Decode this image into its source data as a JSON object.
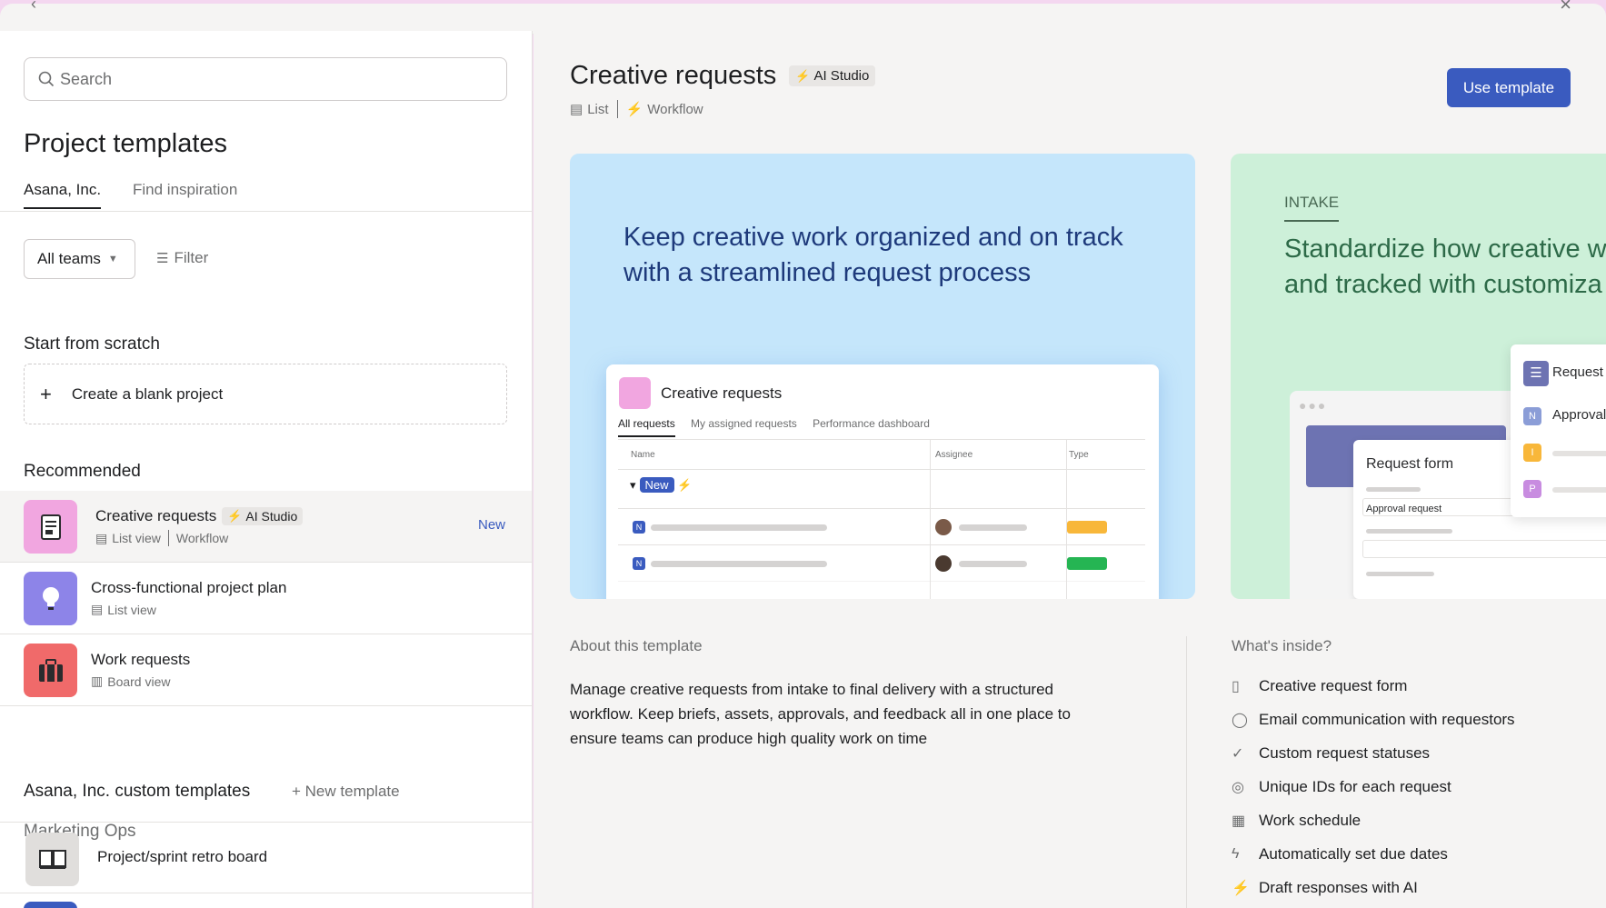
{
  "search": {
    "placeholder": "Search"
  },
  "left": {
    "title": "Project templates",
    "tabs": [
      "Asana, Inc.",
      "Find inspiration"
    ],
    "filters": {
      "teams": "All teams",
      "filter": "Filter"
    },
    "scratch": {
      "heading": "Start from scratch",
      "blank": "Create a blank project"
    },
    "recommended": {
      "heading": "Recommended",
      "items": [
        {
          "name": "Creative requests",
          "badge": "AI Studio",
          "view": "List view",
          "extra": "Workflow",
          "tag": "New",
          "color": "#f1a6e0",
          "icon": "document-icon"
        },
        {
          "name": "Cross-functional project plan",
          "view": "List view",
          "color": "#8d84e8",
          "icon": "lightbulb-icon"
        },
        {
          "name": "Work requests",
          "view": "Board view",
          "color": "#f06a6a",
          "icon": "briefcase-icon"
        }
      ]
    },
    "custom": {
      "heading": "Asana, Inc. custom templates",
      "new": "New template",
      "group": "Marketing Ops",
      "items": [
        {
          "name": "Project/sprint retro board"
        }
      ]
    }
  },
  "preview": {
    "title": "Creative requests",
    "badge": "AI Studio",
    "meta": [
      "List",
      "Workflow"
    ],
    "use_button": "Use template",
    "card1": {
      "headline": "Keep creative work organized and on track with a streamlined request process",
      "mock_title": "Creative requests",
      "mock_tabs": [
        "All requests",
        "My assigned requests",
        "Performance dashboard"
      ],
      "columns": [
        "Name",
        "Assignee",
        "Type"
      ],
      "group": "New",
      "row_type_colors": [
        "#f8b73a",
        "#25b553"
      ]
    },
    "card2": {
      "label": "INTAKE",
      "headline_l1": "Standardize how creative w",
      "headline_l2": "and tracked with customiza",
      "form_title": "Request form",
      "form_field": "Approval request",
      "side_title": "Request",
      "side_item": "Approval r"
    },
    "about": {
      "heading": "About this template",
      "text": "Manage creative requests from intake to final delivery with a structured workflow. Keep briefs, assets, approvals, and feedback all in one place to ensure teams can produce high quality work on time"
    },
    "inside": {
      "heading": "What's inside?",
      "items": [
        {
          "label": "Creative request form",
          "icon": "form-icon"
        },
        {
          "label": "Email communication with requestors",
          "icon": "chat-bubble-icon"
        },
        {
          "label": "Custom request statuses",
          "icon": "check-circle-icon"
        },
        {
          "label": "Unique IDs for each request",
          "icon": "fingerprint-icon"
        },
        {
          "label": "Work schedule",
          "icon": "calendar-icon"
        },
        {
          "label": "Automatically set due dates",
          "icon": "lightning-icon"
        },
        {
          "label": "Draft responses with AI",
          "icon": "ai-lightning-icon"
        }
      ]
    }
  }
}
